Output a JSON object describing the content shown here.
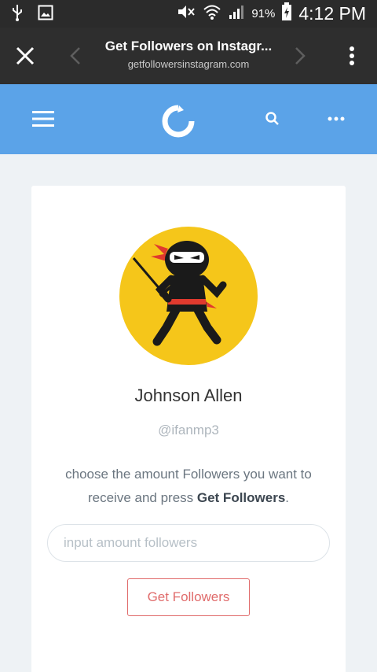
{
  "status_bar": {
    "battery_percent": "91%",
    "time": "4:12 PM",
    "icons": [
      "usb-icon",
      "gallery-icon",
      "mute-icon",
      "wifi-icon",
      "signal-icon",
      "battery-charging-icon"
    ]
  },
  "browser": {
    "title": "Get Followers on Instagr...",
    "url": "getfollowersinstagram.com",
    "icons": [
      "close-icon",
      "back-arrow-icon",
      "forward-arrow-icon",
      "overflow-menu-icon"
    ]
  },
  "header": {
    "background_color": "#5ba3e8",
    "icons": [
      "hamburger-menu-icon",
      "logo-icon",
      "search-icon",
      "more-dots-icon"
    ]
  },
  "profile": {
    "name": "Johnson Allen",
    "handle": "@ifanmp3",
    "avatar": "ninja-avatar-icon"
  },
  "form": {
    "instruction_prefix": "choose the amount Followers you want to receive and press ",
    "instruction_bold": "Get Followers",
    "instruction_suffix": ".",
    "input_placeholder": "input amount followers",
    "input_value": "",
    "button_label": "Get Followers",
    "accent_color": "#e06b6b"
  }
}
